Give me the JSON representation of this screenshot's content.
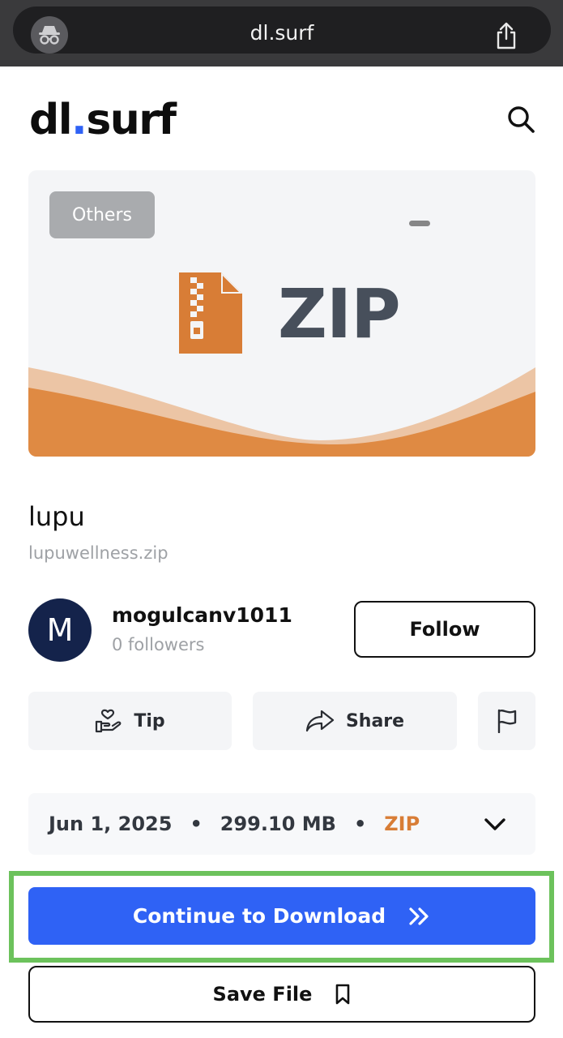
{
  "browser": {
    "url": "dl.surf",
    "incognito_icon": "incognito-icon",
    "share_icon": "share-icon"
  },
  "header": {
    "logo_prefix": "dl",
    "logo_dot": ".",
    "logo_suffix": "surf",
    "search_icon": "search-icon"
  },
  "preview": {
    "category_badge": "Others",
    "file_type_label": "ZIP",
    "colors": {
      "accent": "#d87d36",
      "light_accent": "#ecc5a5"
    }
  },
  "file": {
    "title": "lupu",
    "filename": "lupuwellness.zip"
  },
  "author": {
    "initial": "M",
    "name": "mogulcanv1011",
    "followers": "0 followers",
    "follow_label": "Follow"
  },
  "actions": {
    "tip_label": "Tip",
    "share_label": "Share",
    "report_icon": "flag-icon"
  },
  "info": {
    "date": "Jun 1, 2025",
    "separator": "•",
    "size": "299.10 MB",
    "extension": "ZIP"
  },
  "cta": {
    "download_label": "Continue to Download",
    "save_label": "Save File"
  },
  "colors": {
    "primary": "#2f62f5",
    "highlight": "#6cc25c",
    "avatar_bg": "#14234b"
  }
}
